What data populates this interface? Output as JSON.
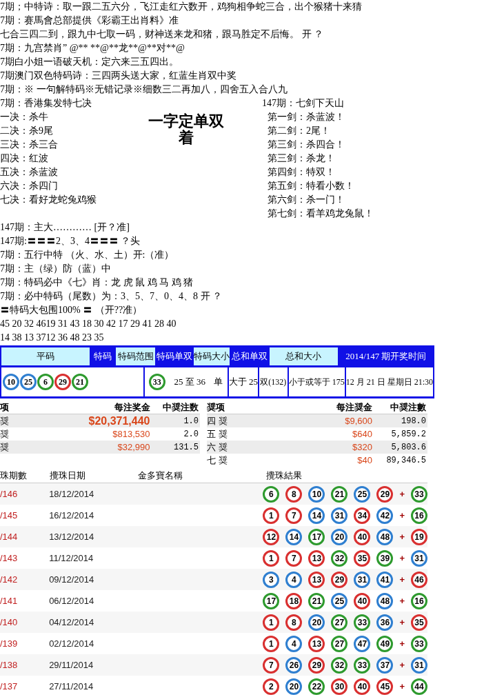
{
  "lines_top": [
    "7期；中特诗：取一跟二五六分，飞江走红六数开，鸡狗相争蛇三合，出个猴猪十来猜",
    "7期：赛馬會总部提供《彩霸王出肖料》准",
    "七合三四二到，跟九中七取一码，财神送来龙和猪，跟马胜定不后悔。 开 ？",
    "7期：九宫禁肖” @** **@**龙**@**对**@",
    "7期白小姐一语破天机：定六来三五四出。",
    "7期澳门双色特码诗：三四两头送大家，红蓝生肖双中奖",
    "7期：※ 一句解特码※无错记录※细数三二再加八，四舍五入合八九"
  ],
  "tips": {
    "title": "7期：香港集发特七决",
    "items": [
      "一决：杀牛",
      "二决：杀9尾",
      "三决：杀三合",
      "四决：红波",
      "五决：杀蓝波",
      "六决：杀四门",
      "七决：看好龙蛇兔鸡猴"
    ]
  },
  "stamp": [
    "一字定单双",
    "着"
  ],
  "swords": {
    "title": "147期：七剑下天山",
    "items": [
      "第一剑：杀蓝波！",
      "第二剑：2尾！",
      "第三剑：杀四合！",
      "第三剑：杀龙！",
      "第四剑：特双！",
      "第五剑：特看小数！",
      "第六剑：杀一门！",
      "第七剑：看羊鸡龙兔鼠！"
    ]
  },
  "lines_bottom": [
    "147期：主大………… [开？准]",
    "147期:〓〓〓2、3、4〓〓〓 ？头",
    "7期：五行中特 （火、水、土）开:（准）",
    "7期：主（绿）防（蓝）中",
    "7期：特码必中《七》肖：龙 虎 鼠 鸡 马 鸡 猪",
    "7期：必中特码（尾数）为：3、5、7、0、4、8 开 ？",
    "〓特码大包围100% 〓 （开??准）",
    "45 20 32 4619 31 43 18 30 42 17 29 41 28 40",
    "14 38 13 3712 36 48 23 35"
  ],
  "draw_table": {
    "headers": [
      {
        "label": "平码",
        "highlighted": true
      },
      {
        "label": "特码",
        "highlighted": false
      },
      {
        "label": "特码范围",
        "highlighted": true
      },
      {
        "label": "特码单双",
        "highlighted": false
      },
      {
        "label": "特码大小",
        "highlighted": true
      },
      {
        "label": "总和单双",
        "highlighted": false
      },
      {
        "label": "总和大小",
        "highlighted": true
      },
      {
        "label": "2014/147 期开奖时间",
        "highlighted": false
      }
    ],
    "balls": [
      {
        "number": "10",
        "color": "#2f7fd0"
      },
      {
        "number": "25",
        "color": "#2f7fd0"
      },
      {
        "number": "6",
        "color": "#2e9a2e"
      },
      {
        "number": "29",
        "color": "#d93030"
      },
      {
        "number": "21",
        "color": "#2e9a2e"
      }
    ],
    "special_ball": {
      "number": "33",
      "color": "#2e9a2e"
    },
    "range": "25 至 36",
    "odd_even": "单",
    "size": "大于 25",
    "sum_odd_even": "双(132)",
    "sum_size": "小于或等于 175",
    "draw_time": "12 月 21 日 星期日 21:30"
  },
  "prizes_left": {
    "columns": [
      "项",
      "每注奖金",
      "中奨注数"
    ],
    "rows": [
      {
        "name": "奨",
        "amount": "$20,371,440",
        "count": "1.0"
      },
      {
        "name": "奨",
        "amount": "$813,530",
        "count": "2.0"
      },
      {
        "name": "奨",
        "amount": "$32,990",
        "count": "131.5"
      }
    ]
  },
  "prizes_right": {
    "columns": [
      "奨项",
      "每注奨金",
      "中奨注數"
    ],
    "rows": [
      {
        "name": "四 奨",
        "amount": "$9,600",
        "count": "198.0"
      },
      {
        "name": "五 奨",
        "amount": "$640",
        "count": "5,859.2"
      },
      {
        "name": "六 奨",
        "amount": "$320",
        "count": "5,803.6"
      },
      {
        "name": "七 奨",
        "amount": "$40",
        "count": "89,346.5"
      }
    ]
  },
  "results": {
    "columns": [
      "珠期數",
      "攪珠日期",
      "金多寶名稱",
      "攪珠結果"
    ],
    "rows": [
      {
        "period": "/146",
        "date": "18/12/2014",
        "balls": [
          {
            "number": "6",
            "color": "#2e9a2e"
          },
          {
            "number": "8",
            "color": "#d93030"
          },
          {
            "number": "10",
            "color": "#2f7fd0"
          },
          {
            "number": "21",
            "color": "#2e9a2e"
          },
          {
            "number": "25",
            "color": "#2f7fd0"
          },
          {
            "number": "29",
            "color": "#d93030"
          }
        ],
        "plus": "+",
        "extra": {
          "number": "33",
          "color": "#2e9a2e"
        }
      },
      {
        "period": "/145",
        "date": "16/12/2014",
        "balls": [
          {
            "number": "1",
            "color": "#d93030"
          },
          {
            "number": "7",
            "color": "#d93030"
          },
          {
            "number": "14",
            "color": "#2f7fd0"
          },
          {
            "number": "31",
            "color": "#2f7fd0"
          },
          {
            "number": "34",
            "color": "#d93030"
          },
          {
            "number": "42",
            "color": "#2f7fd0"
          }
        ],
        "plus": "+",
        "extra": {
          "number": "16",
          "color": "#2e9a2e"
        }
      },
      {
        "period": "/144",
        "date": "13/12/2014",
        "balls": [
          {
            "number": "12",
            "color": "#d93030"
          },
          {
            "number": "14",
            "color": "#2f7fd0"
          },
          {
            "number": "17",
            "color": "#2e9a2e"
          },
          {
            "number": "20",
            "color": "#2f7fd0"
          },
          {
            "number": "40",
            "color": "#d93030"
          },
          {
            "number": "48",
            "color": "#2f7fd0"
          }
        ],
        "plus": "+",
        "extra": {
          "number": "19",
          "color": "#d93030"
        }
      },
      {
        "period": "/143",
        "date": "11/12/2014",
        "balls": [
          {
            "number": "1",
            "color": "#d93030"
          },
          {
            "number": "7",
            "color": "#d93030"
          },
          {
            "number": "13",
            "color": "#d93030"
          },
          {
            "number": "32",
            "color": "#2e9a2e"
          },
          {
            "number": "35",
            "color": "#d93030"
          },
          {
            "number": "39",
            "color": "#2e9a2e"
          }
        ],
        "plus": "+",
        "extra": {
          "number": "31",
          "color": "#2f7fd0"
        }
      },
      {
        "period": "/142",
        "date": "09/12/2014",
        "balls": [
          {
            "number": "3",
            "color": "#2f7fd0"
          },
          {
            "number": "4",
            "color": "#2f7fd0"
          },
          {
            "number": "13",
            "color": "#d93030"
          },
          {
            "number": "29",
            "color": "#d93030"
          },
          {
            "number": "31",
            "color": "#2f7fd0"
          },
          {
            "number": "41",
            "color": "#2f7fd0"
          }
        ],
        "plus": "+",
        "extra": {
          "number": "46",
          "color": "#d93030"
        }
      },
      {
        "period": "/141",
        "date": "06/12/2014",
        "balls": [
          {
            "number": "17",
            "color": "#2e9a2e"
          },
          {
            "number": "18",
            "color": "#d93030"
          },
          {
            "number": "21",
            "color": "#2e9a2e"
          },
          {
            "number": "25",
            "color": "#2f7fd0"
          },
          {
            "number": "40",
            "color": "#d93030"
          },
          {
            "number": "48",
            "color": "#2f7fd0"
          }
        ],
        "plus": "+",
        "extra": {
          "number": "16",
          "color": "#2e9a2e"
        }
      },
      {
        "period": "/140",
        "date": "04/12/2014",
        "balls": [
          {
            "number": "1",
            "color": "#d93030"
          },
          {
            "number": "8",
            "color": "#d93030"
          },
          {
            "number": "20",
            "color": "#2f7fd0"
          },
          {
            "number": "27",
            "color": "#2e9a2e"
          },
          {
            "number": "33",
            "color": "#2e9a2e"
          },
          {
            "number": "36",
            "color": "#2f7fd0"
          }
        ],
        "plus": "+",
        "extra": {
          "number": "35",
          "color": "#d93030"
        }
      },
      {
        "period": "/139",
        "date": "02/12/2014",
        "balls": [
          {
            "number": "1",
            "color": "#d93030"
          },
          {
            "number": "4",
            "color": "#2f7fd0"
          },
          {
            "number": "13",
            "color": "#d93030"
          },
          {
            "number": "27",
            "color": "#2e9a2e"
          },
          {
            "number": "47",
            "color": "#2f7fd0"
          },
          {
            "number": "49",
            "color": "#2e9a2e"
          }
        ],
        "plus": "+",
        "extra": {
          "number": "33",
          "color": "#2e9a2e"
        }
      },
      {
        "period": "/138",
        "date": "29/11/2014",
        "balls": [
          {
            "number": "7",
            "color": "#d93030"
          },
          {
            "number": "26",
            "color": "#2f7fd0"
          },
          {
            "number": "29",
            "color": "#d93030"
          },
          {
            "number": "32",
            "color": "#2e9a2e"
          },
          {
            "number": "33",
            "color": "#2e9a2e"
          },
          {
            "number": "37",
            "color": "#2f7fd0"
          }
        ],
        "plus": "+",
        "extra": {
          "number": "31",
          "color": "#2f7fd0"
        }
      },
      {
        "period": "/137",
        "date": "27/11/2014",
        "balls": [
          {
            "number": "2",
            "color": "#d93030"
          },
          {
            "number": "20",
            "color": "#2f7fd0"
          },
          {
            "number": "22",
            "color": "#2e9a2e"
          },
          {
            "number": "30",
            "color": "#d93030"
          },
          {
            "number": "40",
            "color": "#d93030"
          },
          {
            "number": "45",
            "color": "#d93030"
          }
        ],
        "plus": "+",
        "extra": {
          "number": "44",
          "color": "#2e9a2e"
        }
      }
    ]
  }
}
